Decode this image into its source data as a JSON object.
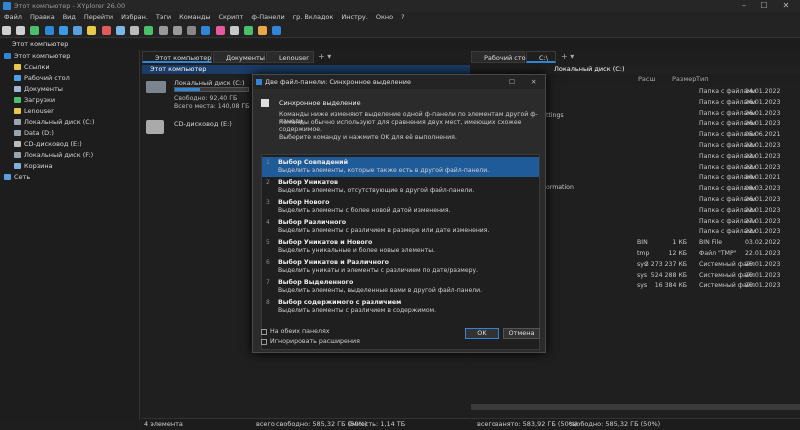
{
  "window": {
    "title": "Этот компьютер - XYplorer 26.00"
  },
  "menu": [
    "Файл",
    "Правка",
    "Вид",
    "Перейти",
    "Избран.",
    "Тэги",
    "Команды",
    "Скрипт",
    "ф-Панели",
    "гр. Вкладок",
    "Инстру.",
    "Окно",
    "?"
  ],
  "left_address": "Этот компьютер",
  "tree": [
    {
      "label": "Этот компьютер",
      "color": "#2f86d6"
    },
    {
      "label": "Ссылки",
      "color": "#e8c84a"
    },
    {
      "label": "Рабочий стол",
      "color": "#4aa3e8"
    },
    {
      "label": "Документы",
      "color": "#9fb6d6"
    },
    {
      "label": "Загрузки",
      "color": "#4ac06b"
    },
    {
      "label": "Lenouser",
      "color": "#e8c84a"
    },
    {
      "label": "Локальный диск (C:)",
      "color": "#9aa5b1"
    },
    {
      "label": "Data (D:)",
      "color": "#9aa5b1"
    },
    {
      "label": "CD-дисковод (E:)",
      "color": "#bbbbbb"
    },
    {
      "label": "Локальный диск (F:)",
      "color": "#9aa5b1"
    },
    {
      "label": "Корзина",
      "color": "#7fb0e0"
    },
    {
      "label": "Сеть",
      "color": "#5aa0e0"
    }
  ],
  "pane1": {
    "tabs": [
      "Этот компьютер",
      "Документы",
      "Lenouser"
    ],
    "path": "Этот компьютер",
    "drive_c": {
      "name": "Локальный диск (C:)",
      "free": "Свободно: 92,40 ГБ",
      "total": "Всего места: 140,08 ГБ",
      "used_fraction": 0.34
    },
    "drive_e": {
      "name": "CD-дисковод (E:)"
    },
    "status": {
      "count": "4 элемента",
      "total": "всего",
      "free": "свободно: 585,32 ГБ (50%)",
      "capacity": "ёмкость: 1,14 ТБ"
    }
  },
  "pane2": {
    "tabs": [
      "Рабочий стол",
      "C:\\"
    ],
    "path": "Локальный диск (C:)",
    "columns": {
      "ext": "Расш",
      "size": "Размер",
      "type": "Тип"
    },
    "partial_names": [
      "ttings",
      "ormation"
    ],
    "rows": [
      {
        "ext": "",
        "size": "",
        "type": "Папка с файлами",
        "date": "14.01.2022"
      },
      {
        "ext": "",
        "size": "",
        "type": "Папка с файлами",
        "date": "26.01.2023"
      },
      {
        "ext": "",
        "size": "",
        "type": "Папка с файлами",
        "date": "26.01.2023"
      },
      {
        "ext": "",
        "size": "",
        "type": "Папка с файлами",
        "date": "26.01.2023"
      },
      {
        "ext": "",
        "size": "",
        "type": "Папка с файлами",
        "date": "05.06.2021"
      },
      {
        "ext": "",
        "size": "",
        "type": "Папка с файлами",
        "date": "22.01.2023"
      },
      {
        "ext": "",
        "size": "",
        "type": "Папка с файлами",
        "date": "22.01.2023"
      },
      {
        "ext": "",
        "size": "",
        "type": "Папка с файлами",
        "date": "22.01.2023"
      },
      {
        "ext": "",
        "size": "",
        "type": "Папка с файлами",
        "date": "10.01.2021"
      },
      {
        "ext": "",
        "size": "",
        "type": "Папка с файлами",
        "date": "09.03.2023"
      },
      {
        "ext": "",
        "size": "",
        "type": "Папка с файлами",
        "date": "26.01.2023"
      },
      {
        "ext": "",
        "size": "",
        "type": "Папка с файлами",
        "date": "22.01.2023"
      },
      {
        "ext": "",
        "size": "",
        "type": "Папка с файлами",
        "date": "27.01.2023"
      },
      {
        "ext": "",
        "size": "",
        "type": "Папка с файлами",
        "date": "22.01.2023"
      },
      {
        "ext": "BIN",
        "size": "1 КБ",
        "type": "BIN File",
        "date": "03.02.2022"
      },
      {
        "ext": "tmp",
        "size": "12 КБ",
        "type": "Файл \"TMP\"",
        "date": "22.01.2023"
      },
      {
        "ext": "sys",
        "size": "3 273 237 КБ",
        "type": "Системный файл",
        "date": "26.01.2023"
      },
      {
        "ext": "sys",
        "size": "524 288 КБ",
        "type": "Системный файл",
        "date": "26.01.2023"
      },
      {
        "ext": "sys",
        "size": "16 384 КБ",
        "type": "Системный файл",
        "date": "26.01.2023"
      }
    ],
    "status": {
      "total": "всего",
      "occupied": "занято: 583,92 ГБ (50%)",
      "free": "свободно: 585,32 ГБ (50%)"
    }
  },
  "dialog": {
    "title": "Две файл-панели: Синхронное выделение",
    "heading": "Синхронное выделение",
    "desc1": "Команды ниже изменяют выделение одной ф-панели по элементам другой ф-панели.",
    "desc2": "Команды обычно используют для сравнения двух мест, имеющих схожее содержимое.",
    "prompt": "Выберите команду и нажмите OK для её выполнения.",
    "options": [
      {
        "n": "1",
        "title": "Выбор Совпадений",
        "desc": "Выделить элементы, которые также есть в другой файл-панели."
      },
      {
        "n": "2",
        "title": "Выбор Уникатов",
        "desc": "Выделить элементы, отсутствующие в другой файл-панели."
      },
      {
        "n": "3",
        "title": "Выбор Нового",
        "desc": "Выделить элементы с более новой датой изменения."
      },
      {
        "n": "4",
        "title": "Выбор Различного",
        "desc": "Выделить элементы с различием в размере или дате изменения."
      },
      {
        "n": "5",
        "title": "Выбор Уникатов и Нового",
        "desc": "Выделить уникальные и более новые элементы."
      },
      {
        "n": "6",
        "title": "Выбор Уникатов и Различного",
        "desc": "Выделить уникаты и элементы с различием по дате/размеру."
      },
      {
        "n": "7",
        "title": "Выбор Выделенного",
        "desc": "Выделить элементы, выделенные вами в другой файл-панели."
      },
      {
        "n": "8",
        "title": "Выбор содержимого с различием",
        "desc": "Выделить элементы с различием в содержимом."
      }
    ],
    "check_both": "На обеих панелях",
    "check_ext": "Игнорировать расширения",
    "ok": "OK",
    "cancel": "Отмена"
  }
}
